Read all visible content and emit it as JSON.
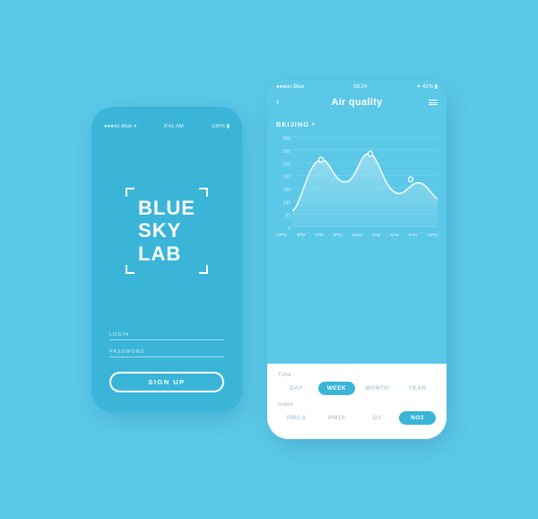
{
  "background": "#5bc8e8",
  "leftPhone": {
    "statusBar": {
      "carrier": "●●●oo Blue",
      "wifi": "WiFi",
      "time": "9:41 AM",
      "battery": "100%"
    },
    "logo": {
      "line1": "BLUE",
      "line2": "SKY",
      "line3": "LAB"
    },
    "loginLabel": "LOGIN",
    "passwordLabel": "PASSWORD",
    "signupButton": "SIGN UP"
  },
  "rightPhone": {
    "statusBar": {
      "carrier": "●●●oo Blue",
      "time": "09:24",
      "bluetooth": "BT",
      "battery": "42%"
    },
    "header": {
      "title": "Air quality",
      "backLabel": "‹",
      "menuLabel": "≡"
    },
    "chart": {
      "city": "BEIJING",
      "yLabels": [
        "350",
        "300",
        "250",
        "200",
        "150",
        "100",
        "50",
        "0"
      ],
      "xLabels": [
        "12PM",
        "3PM",
        "6PM",
        "9PM",
        "12AM",
        "3AM",
        "6AM",
        "9AM",
        "12PM"
      ]
    },
    "timeSection": {
      "label": "Time",
      "options": [
        "DAY",
        "WEEK",
        "MONTH",
        "YEAR"
      ],
      "activeOption": "WEEK"
    },
    "indexSection": {
      "label": "Index",
      "options": [
        "PM2.5",
        "PM10",
        "O3",
        "NO2"
      ],
      "activeOption": "NO2"
    }
  }
}
